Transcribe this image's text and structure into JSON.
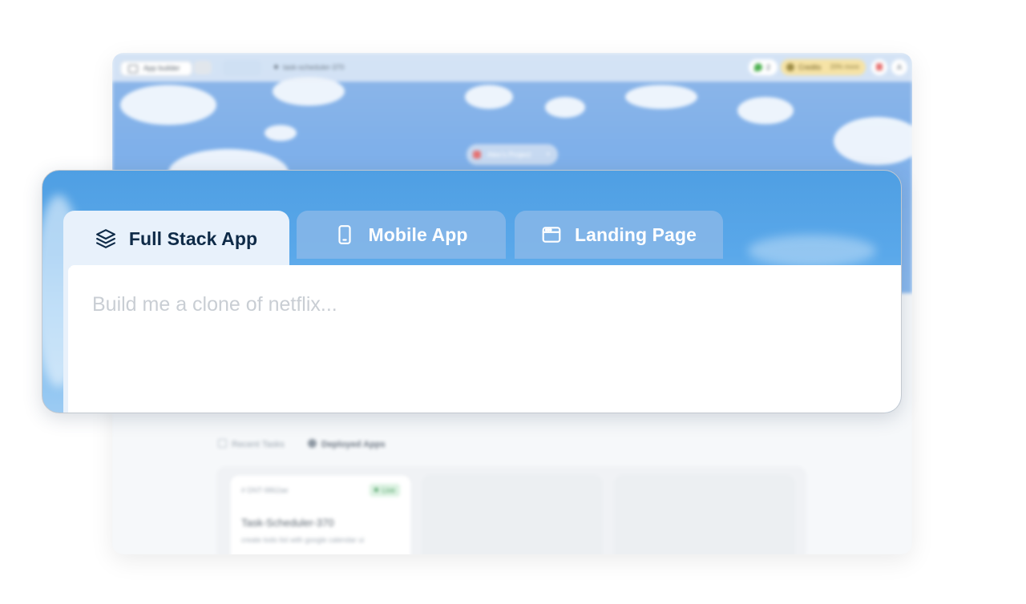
{
  "background_app": {
    "topbar": {
      "app_builder_label": "App builder",
      "breadcrumb": "task-scheduler-370",
      "leaf_count": "2",
      "credits_label": "Credits",
      "credits_more": "20% more",
      "avatar_initial": "A"
    },
    "project_selector": "Alex's Project",
    "tasks_tabs": {
      "recent": "Recent Tasks",
      "deployed": "Deployed Apps"
    },
    "cards": [
      {
        "id": "# DNT-9862ae",
        "status": "Live",
        "title": "Task-Scheduler-370",
        "description": "create todo list with google calendar ui"
      }
    ]
  },
  "composer": {
    "tabs": [
      {
        "label": "Full Stack App",
        "icon": "layers-icon",
        "active": true
      },
      {
        "label": "Mobile App",
        "icon": "mobile-phone-icon",
        "active": false
      },
      {
        "label": "Landing Page",
        "icon": "browser-window-icon",
        "active": false
      }
    ],
    "prompt_placeholder": "Build me a clone of netflix..."
  },
  "colors": {
    "panel_sky": "#5aa8ea",
    "active_tab_bg": "#e8f1fb",
    "active_tab_text": "#0e2a47",
    "inactive_tab_bg": "#8cb9e8",
    "placeholder_text": "#c9ced4"
  }
}
